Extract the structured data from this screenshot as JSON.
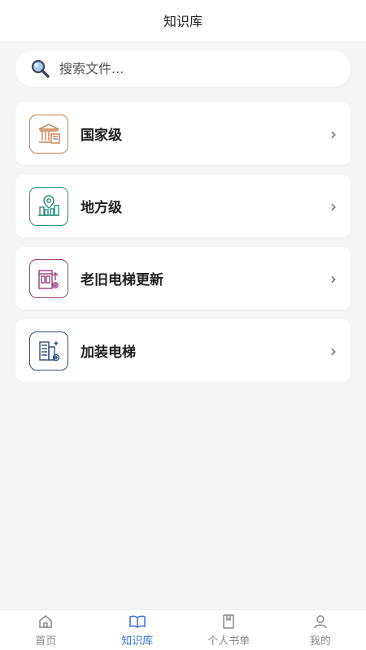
{
  "header": {
    "title": "知识库"
  },
  "search": {
    "placeholder": "搜索文件..."
  },
  "categories": [
    {
      "label": "国家级",
      "icon": "government-building-icon",
      "color": "#c97e4c"
    },
    {
      "label": "地方级",
      "icon": "city-location-icon",
      "color": "#2f8f7f"
    },
    {
      "label": "老旧电梯更新",
      "icon": "elevator-upgrade-icon",
      "color": "#9b3f7a"
    },
    {
      "label": "加装电梯",
      "icon": "building-add-elevator-icon",
      "color": "#2f4d7e"
    }
  ],
  "chevron": "›",
  "tabs": [
    {
      "label": "首页",
      "icon": "home-icon",
      "active": false
    },
    {
      "label": "知识库",
      "icon": "book-icon",
      "active": true
    },
    {
      "label": "个人书单",
      "icon": "bookmark-icon",
      "active": false
    },
    {
      "label": "我的",
      "icon": "user-icon",
      "active": false
    }
  ],
  "colors": {
    "active_tab": "#3a6fd8",
    "inactive_tab": "#888888",
    "background": "#f3f5f8"
  }
}
